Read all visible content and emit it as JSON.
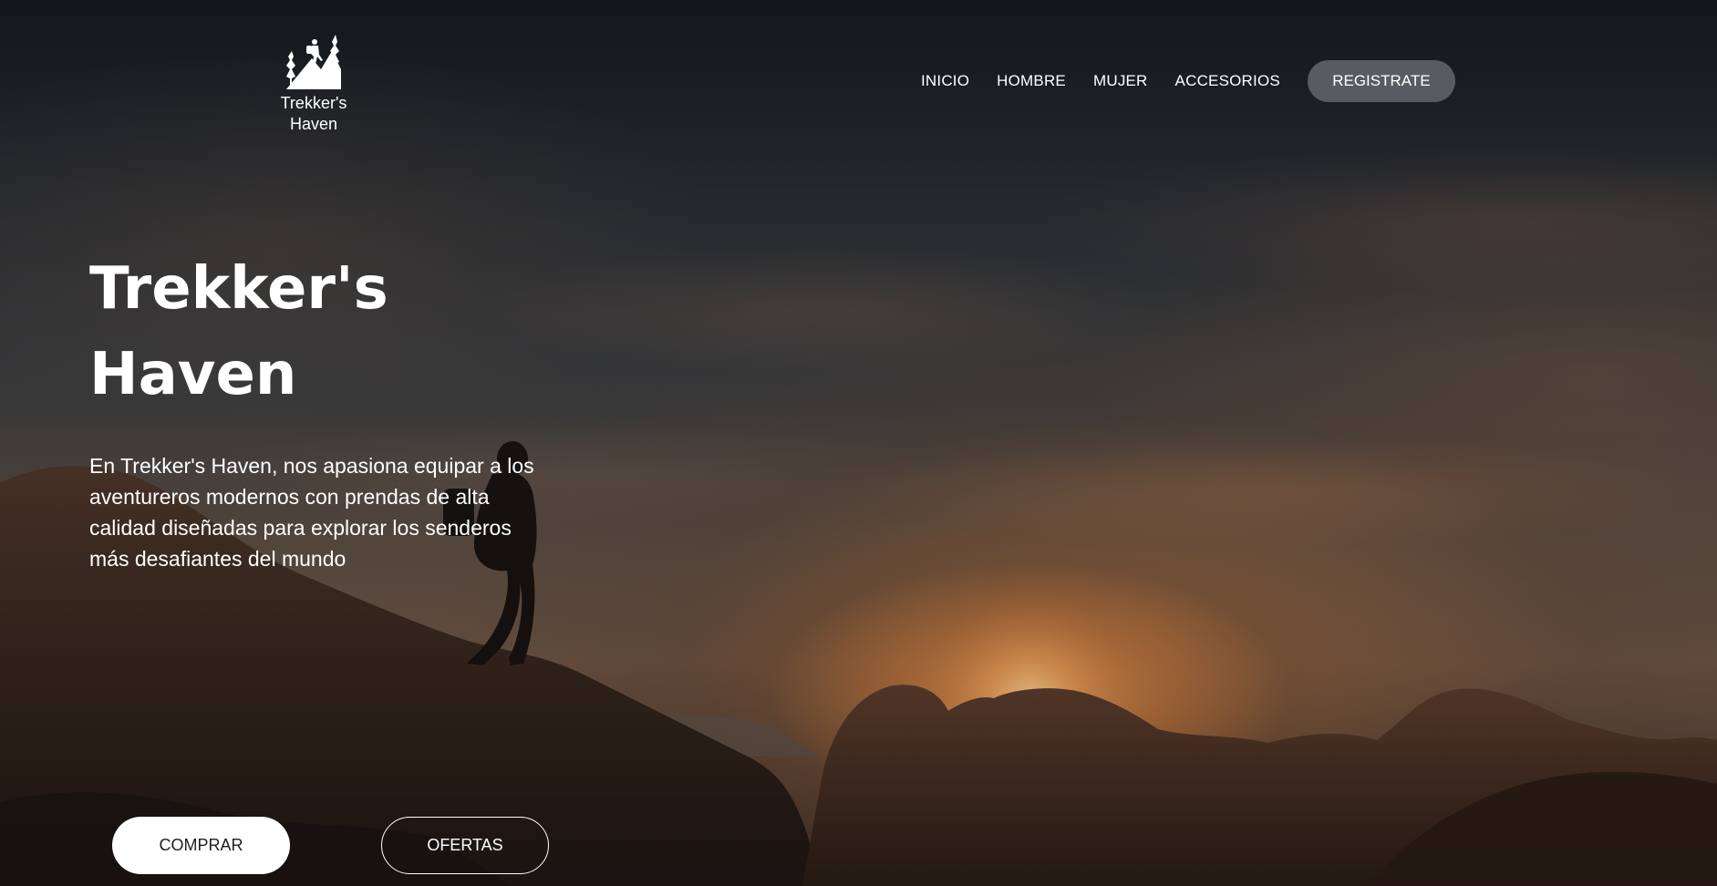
{
  "brand": {
    "logo_icon": "hiker-mountain-icon",
    "name_line1": "Trekker's",
    "name_line2": "Haven"
  },
  "nav": {
    "items": [
      {
        "label": "INICIO"
      },
      {
        "label": "HOMBRE"
      },
      {
        "label": "MUJER"
      },
      {
        "label": "ACCESORIOS"
      }
    ],
    "cta_label": "REGISTRATE"
  },
  "hero": {
    "title_line1": "Trekker's",
    "title_line2": "Haven",
    "description": "En Trekker's Haven, nos apasiona equipar a los aventureros modernos con prendas de alta calidad diseñadas para explorar los senderos más desafiantes del mundo",
    "primary_button": "COMPRAR",
    "secondary_button": "OFERTAS"
  },
  "colors": {
    "text": "#ffffff",
    "cta_background": "#6e7278",
    "primary_button_bg": "#ffffff",
    "primary_button_text": "#1b1f24"
  }
}
